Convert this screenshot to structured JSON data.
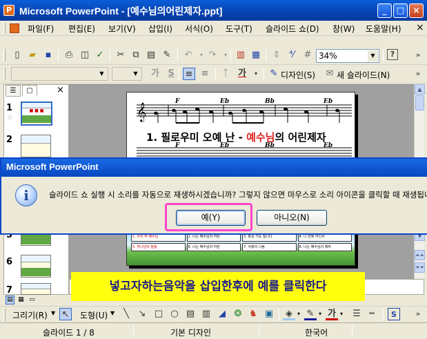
{
  "window": {
    "title": "Microsoft PowerPoint - [예수님의어린제자.ppt]",
    "app_icon": "P",
    "buttons": {
      "minimize": "_",
      "maximize": "□",
      "close": "×"
    }
  },
  "menu": {
    "items": [
      "파일(F)",
      "편집(E)",
      "보기(V)",
      "삽입(I)",
      "서식(O)",
      "도구(T)",
      "슬라이드 쇼(D)",
      "창(W)",
      "도움말(H)"
    ],
    "close_doc": "×"
  },
  "toolbar_standard": {
    "zoom": "34%",
    "help": "?",
    "overflow": "»"
  },
  "toolbar_format": {
    "bold": "가",
    "shadow": "S",
    "font_color_letter": "가",
    "design_label": "디자인(S)",
    "new_slide_label": "새 슬라이드(N)",
    "overflow": "»"
  },
  "slide_panel": {
    "tab_close": "×",
    "slides": [
      {
        "num": "1",
        "star": "☆"
      },
      {
        "num": "2"
      },
      {
        "num": "5"
      },
      {
        "num": "6"
      },
      {
        "num": "7"
      }
    ]
  },
  "slide": {
    "title_part1": "1. 필로우미 오예 난 - ",
    "title_highlight": "예수님",
    "title_part2": "의 어린제자",
    "chords": [
      "F",
      "Eb",
      "Bb",
      "Eb"
    ],
    "chords2": [
      "F",
      "Eb",
      "Bb",
      "Eb"
    ],
    "cells": [
      "1. 우리 주 예수님",
      "2. 나는 예수님의 어린",
      "3. 항상 기도 합니다",
      "4. 나 언제 어디서",
      "5. 하나님의 말씀",
      "6. 나는 예수님의 어린",
      "7. 사랑의 나눔",
      "8. 나는 예수님의 제자"
    ]
  },
  "dialog": {
    "title": "Microsoft PowerPoint",
    "icon": "i",
    "message": "슬라이드 쇼 실행 시 소리를 자동으로 재생하시겠습니까? 그렇지 않으면 마우스로 소리 아이콘을 클릭할 때 재생됩니다.",
    "yes": "예(Y)",
    "no": "아니오(N)"
  },
  "annotation": {
    "caption": "넣고자하는음악을 삽입한후에 예를 클릭한다",
    "highlight_color": "#ff44cc"
  },
  "notes": {
    "text": "여"
  },
  "drawing_toolbar": {
    "draw": "그리기(R)",
    "shapes": "도형(U)",
    "font_color_letter": "가"
  },
  "statusbar": {
    "slide": "슬라이드 1 / 8",
    "design": "기본 디자인",
    "language": "한국어"
  }
}
